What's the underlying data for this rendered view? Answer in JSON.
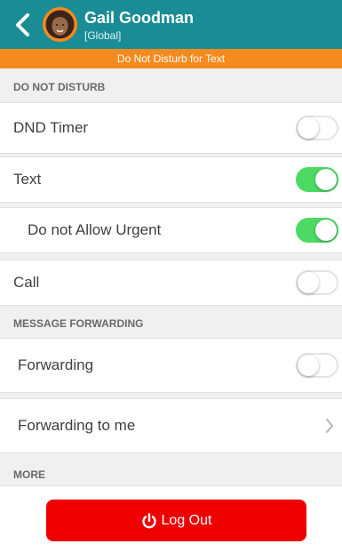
{
  "header": {
    "contact_name": "Gail Goodman",
    "contact_sub": "[Global]",
    "accent_color": "#1a8c95"
  },
  "status_bar": {
    "text": "Do Not Disturb for Text",
    "color": "#f58a1f"
  },
  "sections": {
    "dnd_title": "DO NOT DISTURB",
    "forwarding_title": "MESSAGE FORWARDING",
    "more_title": "MORE"
  },
  "rows": {
    "dnd_timer": {
      "label": "DND Timer",
      "toggle_on": false
    },
    "text": {
      "label": "Text",
      "toggle_on": true
    },
    "not_allow_urgent": {
      "label": "Do not Allow Urgent",
      "toggle_on": true
    },
    "call": {
      "label": "Call",
      "toggle_on": false
    },
    "forwarding": {
      "label": "Forwarding",
      "toggle_on": false
    },
    "forwarding_to_me": {
      "label": "Forwarding to me"
    }
  },
  "logout": {
    "label": "Log Out",
    "color": "#ee0000"
  },
  "icons": {
    "back": "chevron-left-icon",
    "power": "power-icon",
    "chevron": "chevron-right-icon"
  }
}
